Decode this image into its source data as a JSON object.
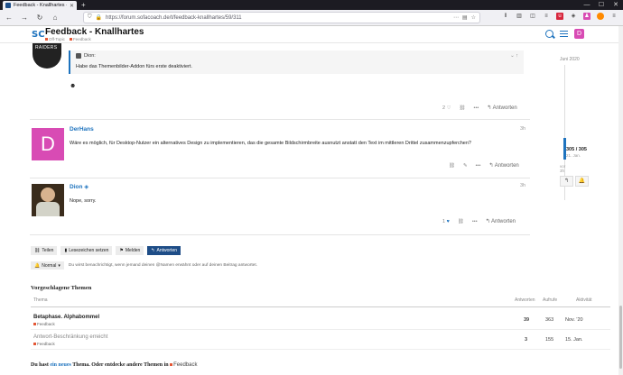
{
  "browser": {
    "tab_title": "Feedback - Knallhartes - Off T",
    "new_tab": "+",
    "url": "https://forum.sofacoach.de/t/feedback-knallhartes/59/311",
    "win": [
      "—",
      "☐",
      "✕"
    ]
  },
  "header": {
    "logo": "SC",
    "title": "Feedback - Knallhartes",
    "cats": [
      "Off-Topic",
      "Feedback"
    ],
    "avatar_letter": "D"
  },
  "quote": {
    "author": "Dion:",
    "text": "Habe das Themenbilder-Addon fürs erste deaktiviert."
  },
  "post1": {
    "likes": "2",
    "reply": "Antworten",
    "emoji": "☻"
  },
  "post2": {
    "avatar_letter": "D",
    "user": "DerHans",
    "time": "3h",
    "text": "Wäre es möglich, für Desktop-Nutzer ein alternatives Design zu implementieren, das die gesamte Bildschirmbreite ausnutzt anstatt den Text im mittleren Drittel zusammenzupferchen?",
    "reply": "Antworten"
  },
  "post3": {
    "user": "Dion",
    "badge": "◈",
    "time": "3h",
    "text": "Nope, sorry.",
    "likes": "1",
    "reply": "Antworten"
  },
  "timeline": {
    "date": "Juni 2020",
    "count": "305 / 305",
    "sub": "21. Jan.",
    "end": "vor 3h"
  },
  "buttons": {
    "share": "Teilen",
    "bookmark": "Lesezeichen setzen",
    "flag": "Melden",
    "reply": "Antworten"
  },
  "notification": {
    "level": "Normal",
    "text": "Du wirst benachrichtigt, wenn jemand deinen @Namen erwähnt oder auf deinen Beitrag antwortet."
  },
  "suggested": {
    "title": "Vorgeschlagene Themen",
    "headers": {
      "topic": "Thema",
      "replies": "Antworten",
      "views": "Aufrufe",
      "activity": "Aktivität"
    },
    "rows": [
      {
        "title": "Betaphase. Alphabommel",
        "category": "Feedback",
        "replies": "39",
        "views": "363",
        "activity": "Nov. '20"
      },
      {
        "title": "Antwort-Beschränkung erreicht",
        "category": "Feedback",
        "replies": "3",
        "views": "155",
        "activity": "15. Jan."
      }
    ]
  },
  "footer": {
    "pre": "Du hast",
    "link": "ein neues",
    "post": "Thema. Oder entdecke andere Themen in",
    "category": "Feedback"
  }
}
